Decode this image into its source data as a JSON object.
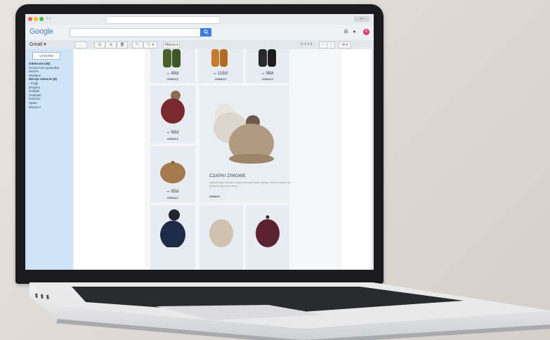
{
  "browser": {
    "window_control": "• •"
  },
  "gmail": {
    "logo": "Google",
    "search_button_icon": "search-icon",
    "gmail_label": "Gmail ▾",
    "compose_label": "UTWÓRZ",
    "avatar_letter": "E",
    "page_count": "1–1 z 1",
    "toolbar_buttons": [
      "←",
      "⊡",
      "⊘",
      "🗑",
      "🏷",
      "🏷 ▾",
      "Więcej ▾",
      "‹",
      "›",
      "⚙ ▾"
    ],
    "sidebar_items": [
      {
        "label": "Odebrane (45)",
        "bold": true
      },
      {
        "label": "Oznaczone gwiazdką",
        "bold": false
      },
      {
        "label": "Ważne",
        "bold": false
      },
      {
        "label": "Wysłane",
        "bold": false
      },
      {
        "label": "Wersje robocze (8)",
        "bold": true
      },
      {
        "label": "› Kręgi",
        "bold": false
      },
      {
        "label": "Znajomi",
        "bold": false
      },
      {
        "label": "Dodatki",
        "bold": false
      },
      {
        "label": "Osobiste",
        "bold": false
      },
      {
        "label": "Podróże",
        "bold": false
      },
      {
        "label": "Spam",
        "bold": false
      },
      {
        "label": "Więcej ▾",
        "bold": false
      }
    ]
  },
  "products": {
    "gloves_green": {
      "old": "—",
      "price": "89zł",
      "button": "ZOBACZ"
    },
    "gloves_orange": {
      "old": "—",
      "price": "119zł",
      "button": "ZOBACZ"
    },
    "gloves_black": {
      "old": "—",
      "price": "99zł",
      "button": "ZOBACZ"
    },
    "hat_red": {
      "old": "—",
      "price": "59zł",
      "button": "ZOBACZ"
    },
    "beret": {
      "old": "—",
      "price": "95zł",
      "button": "ZOBACZ"
    },
    "featured": {
      "title": "CZAPKI ZIMOWE",
      "description": "Najpiękniejsze kolekcje czapek zimowych, które ogrzeją Ciebie w mroźne dni. Sprawdź najnowsze wzory.",
      "button": "ZOBACZ"
    }
  },
  "colors": {
    "gmail_blue": "#3b7de0",
    "sidebar": "#cfe4f6",
    "avatar": "#e7376f"
  }
}
